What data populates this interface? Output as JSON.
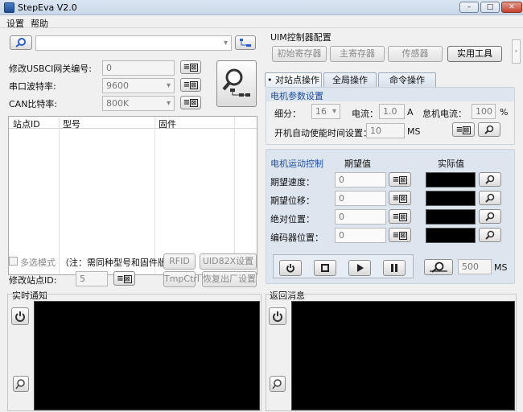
{
  "window": {
    "title": "StepEva V2.0"
  },
  "menu": {
    "settings": "设置",
    "help": "帮助"
  },
  "left": {
    "usb_label": "修改USBCI网关编号:",
    "usb_value": "0",
    "baud_label": "串口波特率:",
    "baud_value": "9600",
    "can_label": "CAN比特率:",
    "can_value": "800K",
    "table_headers": [
      "站点ID",
      "型号",
      "固件"
    ],
    "multi_select_label": "多选模式",
    "note": "（注：需同种型号和固件版本）",
    "rfid_button": "RFID",
    "uid_button": "UID82X设置",
    "modify_station_label": "修改站点ID:",
    "modify_station_value": "5",
    "tmpctrl_button": "TmpCtrl",
    "restore_button": "恢复出厂设置",
    "realtime_label": "实时通知"
  },
  "right": {
    "uim_title": "UIM控制器配置",
    "init_reg_button": "初始寄存器",
    "main_reg_button": "主寄存器",
    "sensor_button": "传感器",
    "tools_button": "实用工具",
    "tabs": [
      "• 对站点操作",
      "全局操作",
      "命令操作"
    ],
    "motor_params_title": "电机参数设置",
    "microstep_label": "细分：",
    "microstep_value": "16",
    "current_label": "电流：",
    "current_value": "1.0",
    "current_unit": "A",
    "idle_label": "怠机电流：",
    "idle_value": "100",
    "idle_unit": "%",
    "autoenable_label": "开机自动使能时间设置：",
    "autoenable_value": "10",
    "autoenable_unit": "MS",
    "motion_title": "电机运动控制",
    "expected_header": "期望值",
    "actual_header": "实际值",
    "rows": [
      {
        "label": "期望速度：",
        "value": "0"
      },
      {
        "label": "期望位移：",
        "value": "0"
      },
      {
        "label": "绝对位置：",
        "value": "0"
      },
      {
        "label": "编码器位置：",
        "value": "0"
      }
    ],
    "interval_value": "500",
    "interval_unit": "MS",
    "return_label": "返回消息"
  }
}
